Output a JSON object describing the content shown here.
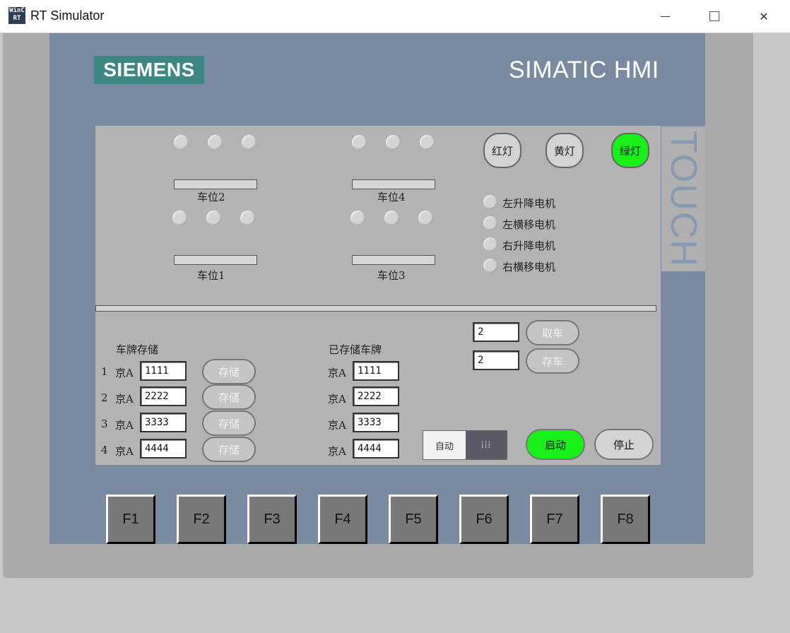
{
  "window": {
    "title": "RT Simulator",
    "icon_text_top": "WinC",
    "icon_text_bottom": "RT"
  },
  "panel": {
    "brand": "SIEMENS",
    "model": "SIMATIC HMI",
    "touch_label": "TOUCH"
  },
  "parking": {
    "slots": [
      {
        "label": "车位2"
      },
      {
        "label": "车位4"
      },
      {
        "label": "车位1"
      },
      {
        "label": "车位3"
      }
    ]
  },
  "lights": {
    "red": "红灯",
    "yellow": "黄灯",
    "green": "绿灯",
    "active": "green",
    "active_color": "#19f019"
  },
  "motors": [
    "左升降电机",
    "左横移电机",
    "右升降电机",
    "右横移电机"
  ],
  "storage": {
    "title": "车牌存储",
    "rows": [
      {
        "index": "1",
        "prefix": "京A",
        "value": "1111",
        "button": "存储"
      },
      {
        "index": "2",
        "prefix": "京A",
        "value": "2222",
        "button": "存储"
      },
      {
        "index": "3",
        "prefix": "京A",
        "value": "3333",
        "button": "存储"
      },
      {
        "index": "4",
        "prefix": "京A",
        "value": "4444",
        "button": "存储"
      }
    ]
  },
  "stored": {
    "title": "已存储车牌",
    "rows": [
      {
        "prefix": "京A",
        "value": "1111"
      },
      {
        "prefix": "京A",
        "value": "2222"
      },
      {
        "prefix": "京A",
        "value": "3333"
      },
      {
        "prefix": "京A",
        "value": "4444"
      }
    ]
  },
  "retrieve": {
    "value": "2",
    "button": "取车"
  },
  "park": {
    "value": "2",
    "button": "存车"
  },
  "mode": {
    "label": "自动",
    "knob": "⁞⁞⁞"
  },
  "controls": {
    "start": "启动",
    "stop": "停止"
  },
  "function_keys": [
    "F1",
    "F2",
    "F3",
    "F4",
    "F5",
    "F6",
    "F7",
    "F8"
  ]
}
